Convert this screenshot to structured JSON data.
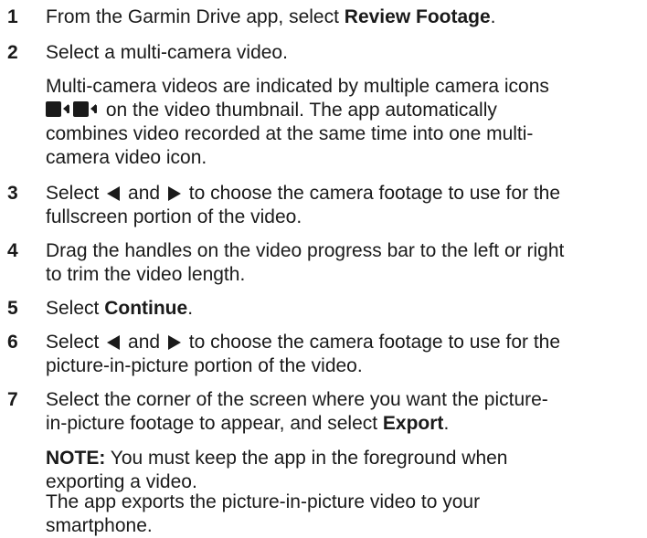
{
  "steps": [
    {
      "num": "1",
      "pre": "From the Garmin Drive app, select ",
      "bold": "Review Footage",
      "post": "."
    },
    {
      "num": "2",
      "text": "Select a multi-camera video."
    },
    {
      "note_multicam": {
        "line1": "Multi-camera videos are indicated by multiple camera icons",
        "line2_post": " on the video thumbnail. The app automatically",
        "line3": "combines video recorded at the same time into one multi-",
        "line4": "camera video icon."
      }
    },
    {
      "num": "3",
      "pre": "Select ",
      "mid": " and ",
      "post1": " to choose the camera footage to use for the",
      "line2": "fullscreen portion of the video."
    },
    {
      "num": "4",
      "line1": "Drag the handles on the video progress bar to the left or right",
      "line2": "to trim the video length."
    },
    {
      "num": "5",
      "pre": "Select ",
      "bold": "Continue",
      "post": "."
    },
    {
      "num": "6",
      "pre": "Select ",
      "mid": " and ",
      "post1": " to choose the camera footage to use for the",
      "line2": "picture-in-picture portion of the video."
    },
    {
      "num": "7",
      "line1": "Select the corner of the screen where you want the picture-",
      "line2_pre": "in-picture footage to appear, and select ",
      "line2_bold": "Export",
      "line2_post": "."
    }
  ],
  "note": {
    "label": "NOTE:",
    "line1": " You must keep the app in the foreground when",
    "line2": "exporting a video."
  },
  "final": {
    "line1": "The app exports the picture-in-picture video to your",
    "line2": "smartphone."
  },
  "icons": {
    "camera": "video-camera-icon",
    "left": "left-arrow-icon",
    "right": "right-arrow-icon"
  }
}
